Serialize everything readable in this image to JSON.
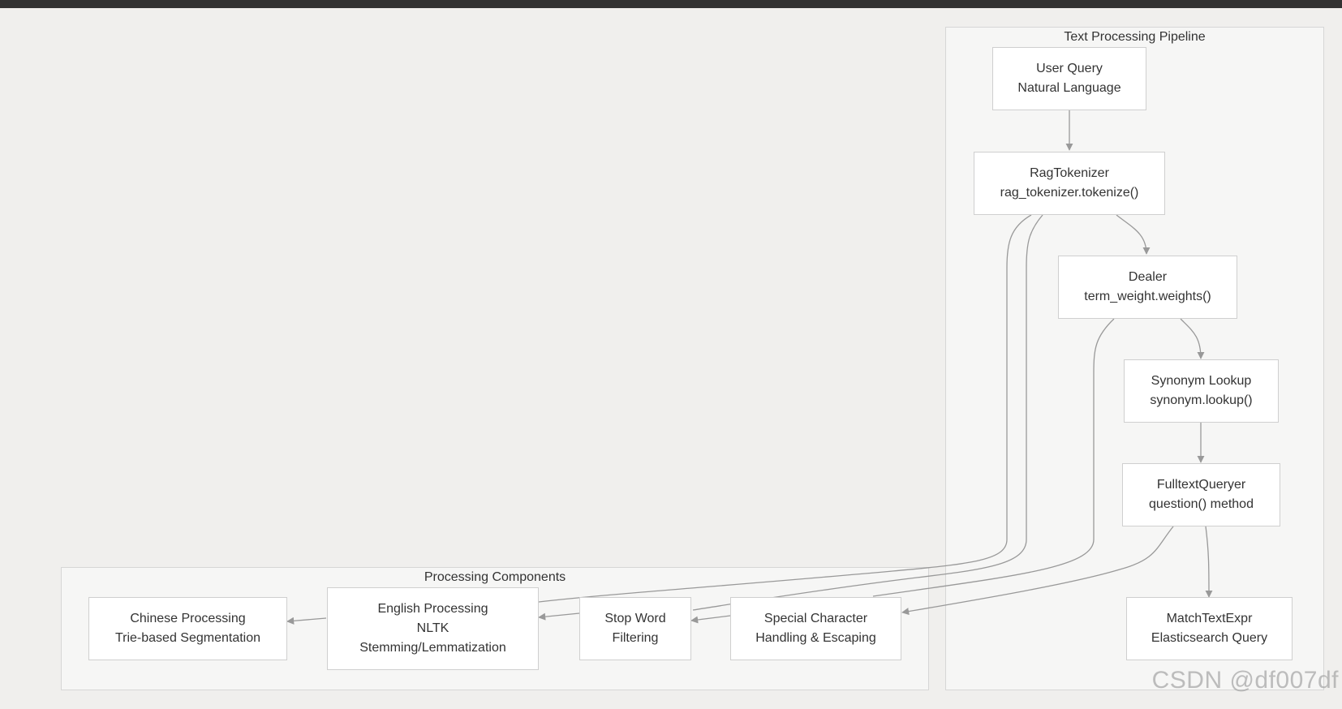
{
  "clusters": {
    "pipeline": {
      "title": "Text Processing Pipeline"
    },
    "components": {
      "title": "Processing Components"
    }
  },
  "nodes": {
    "user_query": {
      "line1": "User Query",
      "line2": "Natural Language"
    },
    "rag_tokenizer": {
      "line1": "RagTokenizer",
      "line2": "rag_tokenizer.tokenize()"
    },
    "dealer": {
      "line1": "Dealer",
      "line2": "term_weight.weights()"
    },
    "synonym": {
      "line1": "Synonym Lookup",
      "line2": "synonym.lookup()"
    },
    "fulltext": {
      "line1": "FulltextQueryer",
      "line2": "question() method"
    },
    "match_text": {
      "line1": "MatchTextExpr",
      "line2": "Elasticsearch Query"
    },
    "chinese": {
      "line1": "Chinese Processing",
      "line2": "Trie-based Segmentation"
    },
    "english": {
      "line1": "English Processing",
      "line2": "NLTK",
      "line3": "Stemming/Lemmatization"
    },
    "stopword": {
      "line1": "Stop Word",
      "line2": "Filtering"
    },
    "special": {
      "line1": "Special Character",
      "line2": "Handling & Escaping"
    }
  },
  "colors": {
    "background": "#f0efed",
    "cluster_fill": "#f6f6f5",
    "node_fill": "#ffffff",
    "edge": "#999999",
    "text": "#333333"
  },
  "watermark": "CSDN @df007df"
}
